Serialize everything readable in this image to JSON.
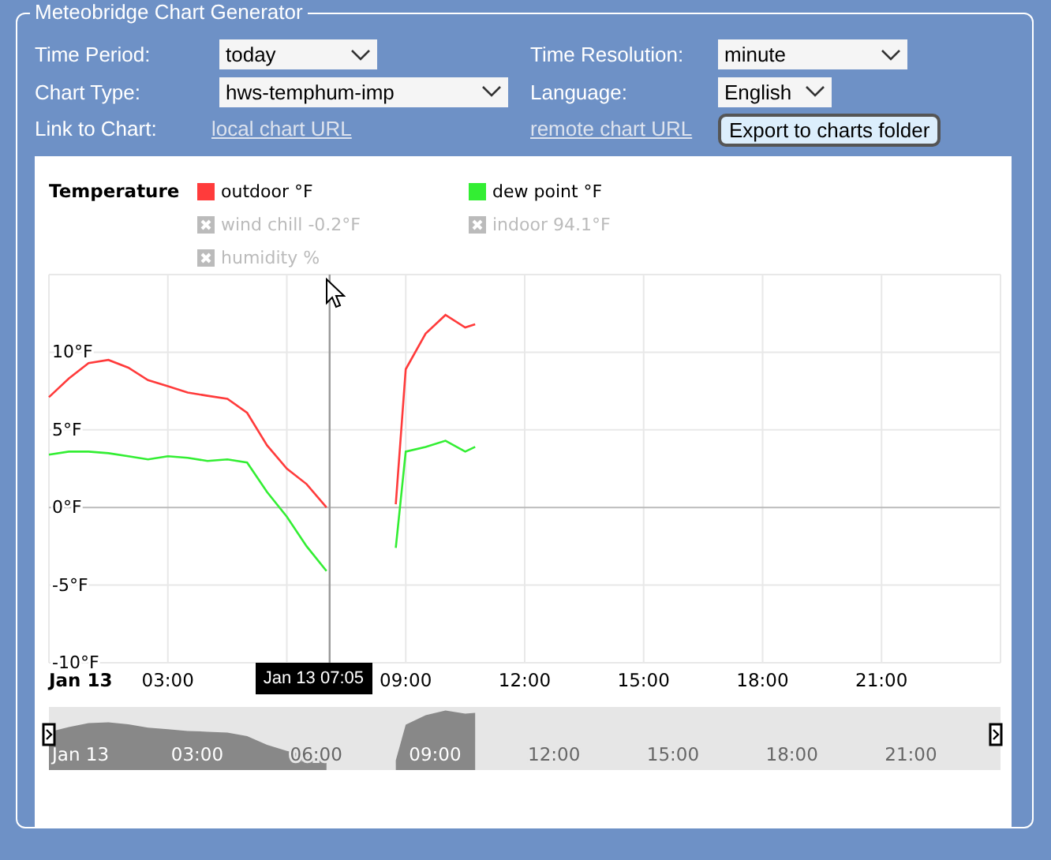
{
  "panel": {
    "title": "Meteobridge Chart Generator"
  },
  "form": {
    "fields": [
      {
        "label": "Time Period:",
        "value": "today",
        "kind": "select"
      },
      {
        "label": "Time Resolution:",
        "value": "minute",
        "kind": "select"
      },
      {
        "label": "Chart Type:",
        "value": "hws-temphum-imp",
        "kind": "select"
      },
      {
        "label": "Language:",
        "value": "English",
        "kind": "select"
      },
      {
        "label": "Link to Chart:",
        "value": "local chart URL",
        "kind": "link"
      },
      {
        "value": "remote chart URL",
        "kind": "link"
      }
    ],
    "button": "Export to charts folder"
  },
  "chart": {
    "title": "Temperature",
    "hidden_series": [
      {
        "label": "wind chill -0.2°F",
        "visible": false
      },
      {
        "label": "indoor 94.1°F",
        "visible": false
      },
      {
        "label": "humidity %",
        "visible": false
      }
    ],
    "chart_data": {
      "type": "line",
      "grid": true,
      "x": [
        0,
        0.5,
        1,
        1.5,
        2,
        2.5,
        3,
        3.5,
        4,
        4.5,
        5,
        5.5,
        6,
        6.5,
        7,
        7.5,
        8,
        8.75,
        9,
        9.5,
        10,
        10.5,
        10.75
      ],
      "series": [
        {
          "name": "outdoor °F",
          "color": "#ff3b3b",
          "values": [
            7.1,
            8.3,
            9.3,
            9.5,
            9.0,
            8.2,
            7.8,
            7.4,
            7.2,
            7.0,
            6.1,
            4.0,
            2.5,
            1.5,
            0.0,
            null,
            null,
            0.2,
            8.9,
            11.2,
            12.4,
            11.6,
            11.8
          ]
        },
        {
          "name": "dew point °F",
          "color": "#33ee33",
          "values": [
            3.4,
            3.6,
            3.6,
            3.5,
            3.3,
            3.1,
            3.3,
            3.2,
            3.0,
            3.1,
            2.9,
            1.0,
            -0.6,
            -2.5,
            -4.1,
            null,
            null,
            -2.6,
            3.6,
            3.9,
            4.3,
            3.6,
            3.9
          ]
        }
      ],
      "xlim": [
        0,
        24
      ],
      "ylim": [
        -10,
        15
      ],
      "xticks": [
        {
          "value": 0,
          "label": "Jan 13"
        },
        {
          "value": 3,
          "label": "03:00"
        },
        {
          "value": 9,
          "label": "09:00"
        },
        {
          "value": 12,
          "label": "12:00"
        },
        {
          "value": 15,
          "label": "15:00"
        },
        {
          "value": 18,
          "label": "18:00"
        },
        {
          "value": 21,
          "label": "21:00"
        }
      ],
      "yticks": [
        {
          "value": -10,
          "label": "-10°F"
        },
        {
          "value": -5,
          "label": "-5°F"
        },
        {
          "value": 0,
          "label": "0°F"
        },
        {
          "value": 5,
          "label": "5°F"
        },
        {
          "value": 10,
          "label": "10°F"
        }
      ],
      "ref_lines": [
        {
          "axis": "x",
          "value": 7.08
        }
      ]
    },
    "tooltip": "Jan 13 07:05",
    "navigator": {
      "labels": [
        "Jan 13",
        "03:00",
        "06:00",
        "09:00",
        "12:00",
        "15:00",
        "18:00",
        "21:00"
      ]
    }
  }
}
